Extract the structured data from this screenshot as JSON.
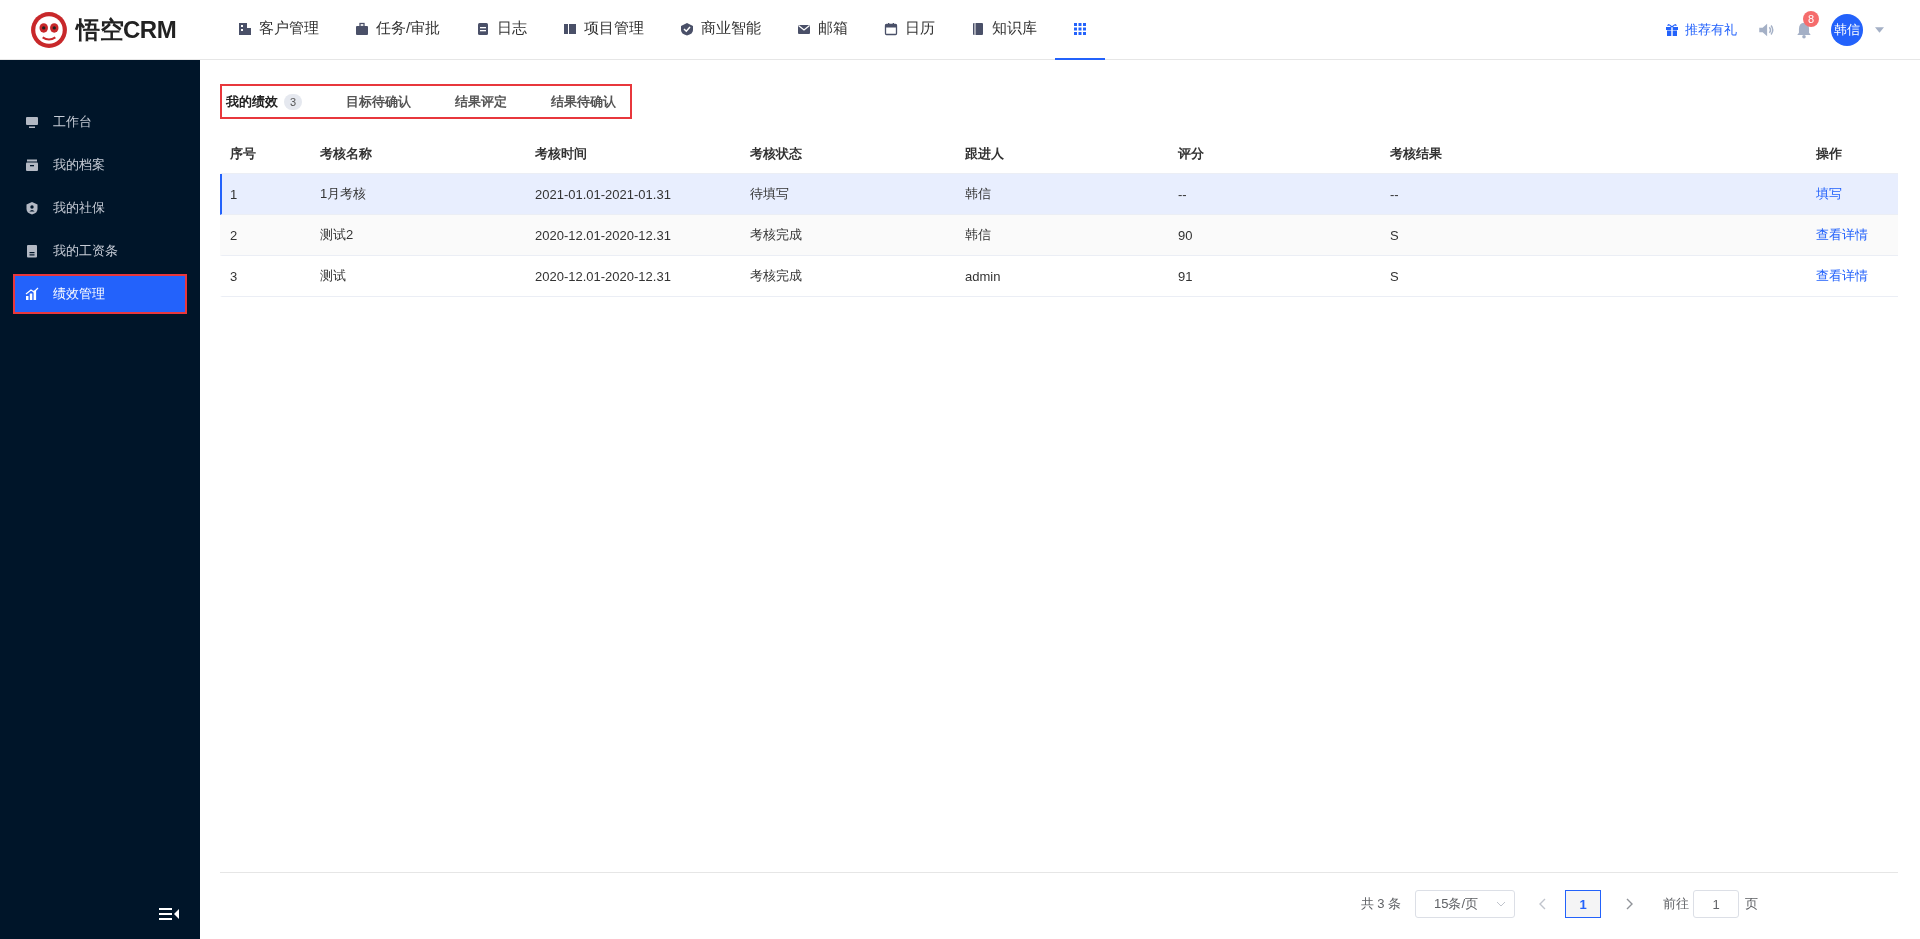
{
  "header": {
    "logo_text": "悟空CRM",
    "nav": [
      {
        "label": "客户管理",
        "selected": false
      },
      {
        "label": "任务/审批",
        "selected": false
      },
      {
        "label": "日志",
        "selected": false
      },
      {
        "label": "项目管理",
        "selected": false
      },
      {
        "label": "商业智能",
        "selected": false
      },
      {
        "label": "邮箱",
        "selected": false
      },
      {
        "label": "日历",
        "selected": false
      },
      {
        "label": "知识库",
        "selected": false
      },
      {
        "selected": true
      }
    ],
    "referral_link": "推荐有礼",
    "notification_count": "8",
    "user_avatar": "韩信"
  },
  "sidebar": {
    "items": [
      {
        "label": "工作台",
        "selected": false
      },
      {
        "label": "我的档案",
        "selected": false
      },
      {
        "label": "我的社保",
        "selected": false
      },
      {
        "label": "我的工资条",
        "selected": false
      },
      {
        "label": "绩效管理",
        "selected": true,
        "highlighted": true
      }
    ]
  },
  "tabs": {
    "highlighted": true,
    "items": [
      {
        "label": "我的绩效",
        "count": "3",
        "selected": true
      },
      {
        "label": "目标待确认",
        "selected": false
      },
      {
        "label": "结果评定",
        "selected": false
      },
      {
        "label": "结果待确认",
        "selected": false
      }
    ]
  },
  "table": {
    "columns": [
      "序号",
      "考核名称",
      "考核时间",
      "考核状态",
      "跟进人",
      "评分",
      "考核结果",
      "操作"
    ],
    "rows": [
      {
        "cells": [
          "1",
          "1月考核",
          "2021-01.01-2021-01.31",
          "待填写",
          "韩信",
          "--",
          "--"
        ],
        "action": "填写",
        "selected": true
      },
      {
        "cells": [
          "2",
          "测试2",
          "2020-12.01-2020-12.31",
          "考核完成",
          "韩信",
          "90",
          "S"
        ],
        "action": "查看详情",
        "selected": false
      },
      {
        "cells": [
          "3",
          "测试",
          "2020-12.01-2020-12.31",
          "考核完成",
          "admin",
          "91",
          "S"
        ],
        "action": "查看详情",
        "selected": false
      }
    ]
  },
  "pagination": {
    "total": "共 3 条",
    "page_size": "15条/页",
    "pages": [
      {
        "label": "1",
        "selected": true
      }
    ],
    "goto_label": "前往",
    "goto_value": "1",
    "goto_suffix": "页"
  }
}
